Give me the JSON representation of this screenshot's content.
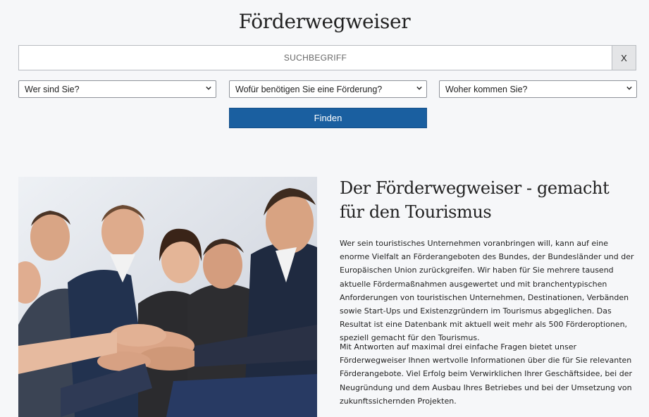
{
  "header": {
    "title": "Förderwegweiser"
  },
  "search": {
    "placeholder": "SUCHBEGRIFF",
    "value": "",
    "clear_label": "X"
  },
  "filters": [
    {
      "selected": "Wer sind Sie?"
    },
    {
      "selected": "Wofür benötigen Sie eine Förderung?"
    },
    {
      "selected": "Woher kommen Sie?"
    }
  ],
  "find_button": {
    "label": "Finden"
  },
  "article": {
    "heading": "Der Förderwegweiser - gemacht für den Tourismus",
    "paragraphs": [
      "Wer sein touristisches Unternehmen voranbringen will, kann auf eine enorme Vielfalt an Förderangeboten des Bundes, der Bundesländer und der Europäischen Union zurückgreifen. Wir haben für Sie mehrere tausend aktuelle Fördermaßnahmen ausgewertet und mit branchentypischen Anforderungen von touristischen Unternehmen, Destinationen, Verbänden sowie Start-Ups und Existenzgründern im Tourismus abgeglichen. Das Resultat ist eine Datenbank mit aktuell weit mehr als 500 Förderoptionen, speziell gemacht für den Tourismus.",
      "Mit Antworten auf maximal drei einfache Fragen bietet unser Förderwegweiser Ihnen wertvolle Informationen über die für Sie relevanten Förderangebote. Viel Erfolg beim Verwirklichen Ihrer Geschäftsidee, bei der Neugründung und dem Ausbau Ihres Betriebes und bei der Umsetzung von zukunftssichernden Projekten."
    ]
  },
  "colors": {
    "accent": "#1a5fa0",
    "background": "#f6f7f9"
  }
}
